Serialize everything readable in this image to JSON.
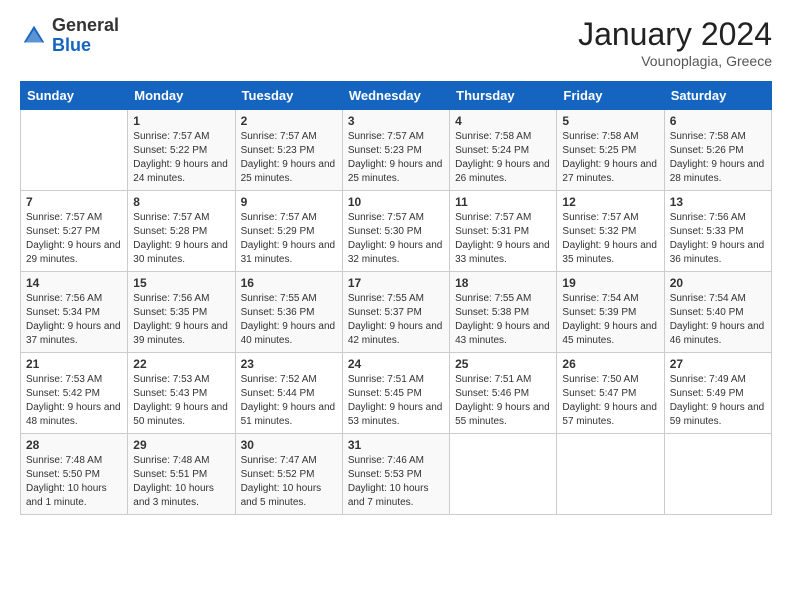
{
  "header": {
    "logo_general": "General",
    "logo_blue": "Blue",
    "month_title": "January 2024",
    "location": "Vounoplagia, Greece"
  },
  "days_of_week": [
    "Sunday",
    "Monday",
    "Tuesday",
    "Wednesday",
    "Thursday",
    "Friday",
    "Saturday"
  ],
  "weeks": [
    [
      {
        "day": "",
        "sunrise": "",
        "sunset": "",
        "daylight": ""
      },
      {
        "day": "1",
        "sunrise": "Sunrise: 7:57 AM",
        "sunset": "Sunset: 5:22 PM",
        "daylight": "Daylight: 9 hours and 24 minutes."
      },
      {
        "day": "2",
        "sunrise": "Sunrise: 7:57 AM",
        "sunset": "Sunset: 5:23 PM",
        "daylight": "Daylight: 9 hours and 25 minutes."
      },
      {
        "day": "3",
        "sunrise": "Sunrise: 7:57 AM",
        "sunset": "Sunset: 5:23 PM",
        "daylight": "Daylight: 9 hours and 25 minutes."
      },
      {
        "day": "4",
        "sunrise": "Sunrise: 7:58 AM",
        "sunset": "Sunset: 5:24 PM",
        "daylight": "Daylight: 9 hours and 26 minutes."
      },
      {
        "day": "5",
        "sunrise": "Sunrise: 7:58 AM",
        "sunset": "Sunset: 5:25 PM",
        "daylight": "Daylight: 9 hours and 27 minutes."
      },
      {
        "day": "6",
        "sunrise": "Sunrise: 7:58 AM",
        "sunset": "Sunset: 5:26 PM",
        "daylight": "Daylight: 9 hours and 28 minutes."
      }
    ],
    [
      {
        "day": "7",
        "sunrise": "Sunrise: 7:57 AM",
        "sunset": "Sunset: 5:27 PM",
        "daylight": "Daylight: 9 hours and 29 minutes."
      },
      {
        "day": "8",
        "sunrise": "Sunrise: 7:57 AM",
        "sunset": "Sunset: 5:28 PM",
        "daylight": "Daylight: 9 hours and 30 minutes."
      },
      {
        "day": "9",
        "sunrise": "Sunrise: 7:57 AM",
        "sunset": "Sunset: 5:29 PM",
        "daylight": "Daylight: 9 hours and 31 minutes."
      },
      {
        "day": "10",
        "sunrise": "Sunrise: 7:57 AM",
        "sunset": "Sunset: 5:30 PM",
        "daylight": "Daylight: 9 hours and 32 minutes."
      },
      {
        "day": "11",
        "sunrise": "Sunrise: 7:57 AM",
        "sunset": "Sunset: 5:31 PM",
        "daylight": "Daylight: 9 hours and 33 minutes."
      },
      {
        "day": "12",
        "sunrise": "Sunrise: 7:57 AM",
        "sunset": "Sunset: 5:32 PM",
        "daylight": "Daylight: 9 hours and 35 minutes."
      },
      {
        "day": "13",
        "sunrise": "Sunrise: 7:56 AM",
        "sunset": "Sunset: 5:33 PM",
        "daylight": "Daylight: 9 hours and 36 minutes."
      }
    ],
    [
      {
        "day": "14",
        "sunrise": "Sunrise: 7:56 AM",
        "sunset": "Sunset: 5:34 PM",
        "daylight": "Daylight: 9 hours and 37 minutes."
      },
      {
        "day": "15",
        "sunrise": "Sunrise: 7:56 AM",
        "sunset": "Sunset: 5:35 PM",
        "daylight": "Daylight: 9 hours and 39 minutes."
      },
      {
        "day": "16",
        "sunrise": "Sunrise: 7:55 AM",
        "sunset": "Sunset: 5:36 PM",
        "daylight": "Daylight: 9 hours and 40 minutes."
      },
      {
        "day": "17",
        "sunrise": "Sunrise: 7:55 AM",
        "sunset": "Sunset: 5:37 PM",
        "daylight": "Daylight: 9 hours and 42 minutes."
      },
      {
        "day": "18",
        "sunrise": "Sunrise: 7:55 AM",
        "sunset": "Sunset: 5:38 PM",
        "daylight": "Daylight: 9 hours and 43 minutes."
      },
      {
        "day": "19",
        "sunrise": "Sunrise: 7:54 AM",
        "sunset": "Sunset: 5:39 PM",
        "daylight": "Daylight: 9 hours and 45 minutes."
      },
      {
        "day": "20",
        "sunrise": "Sunrise: 7:54 AM",
        "sunset": "Sunset: 5:40 PM",
        "daylight": "Daylight: 9 hours and 46 minutes."
      }
    ],
    [
      {
        "day": "21",
        "sunrise": "Sunrise: 7:53 AM",
        "sunset": "Sunset: 5:42 PM",
        "daylight": "Daylight: 9 hours and 48 minutes."
      },
      {
        "day": "22",
        "sunrise": "Sunrise: 7:53 AM",
        "sunset": "Sunset: 5:43 PM",
        "daylight": "Daylight: 9 hours and 50 minutes."
      },
      {
        "day": "23",
        "sunrise": "Sunrise: 7:52 AM",
        "sunset": "Sunset: 5:44 PM",
        "daylight": "Daylight: 9 hours and 51 minutes."
      },
      {
        "day": "24",
        "sunrise": "Sunrise: 7:51 AM",
        "sunset": "Sunset: 5:45 PM",
        "daylight": "Daylight: 9 hours and 53 minutes."
      },
      {
        "day": "25",
        "sunrise": "Sunrise: 7:51 AM",
        "sunset": "Sunset: 5:46 PM",
        "daylight": "Daylight: 9 hours and 55 minutes."
      },
      {
        "day": "26",
        "sunrise": "Sunrise: 7:50 AM",
        "sunset": "Sunset: 5:47 PM",
        "daylight": "Daylight: 9 hours and 57 minutes."
      },
      {
        "day": "27",
        "sunrise": "Sunrise: 7:49 AM",
        "sunset": "Sunset: 5:49 PM",
        "daylight": "Daylight: 9 hours and 59 minutes."
      }
    ],
    [
      {
        "day": "28",
        "sunrise": "Sunrise: 7:48 AM",
        "sunset": "Sunset: 5:50 PM",
        "daylight": "Daylight: 10 hours and 1 minute."
      },
      {
        "day": "29",
        "sunrise": "Sunrise: 7:48 AM",
        "sunset": "Sunset: 5:51 PM",
        "daylight": "Daylight: 10 hours and 3 minutes."
      },
      {
        "day": "30",
        "sunrise": "Sunrise: 7:47 AM",
        "sunset": "Sunset: 5:52 PM",
        "daylight": "Daylight: 10 hours and 5 minutes."
      },
      {
        "day": "31",
        "sunrise": "Sunrise: 7:46 AM",
        "sunset": "Sunset: 5:53 PM",
        "daylight": "Daylight: 10 hours and 7 minutes."
      },
      {
        "day": "",
        "sunrise": "",
        "sunset": "",
        "daylight": ""
      },
      {
        "day": "",
        "sunrise": "",
        "sunset": "",
        "daylight": ""
      },
      {
        "day": "",
        "sunrise": "",
        "sunset": "",
        "daylight": ""
      }
    ]
  ]
}
